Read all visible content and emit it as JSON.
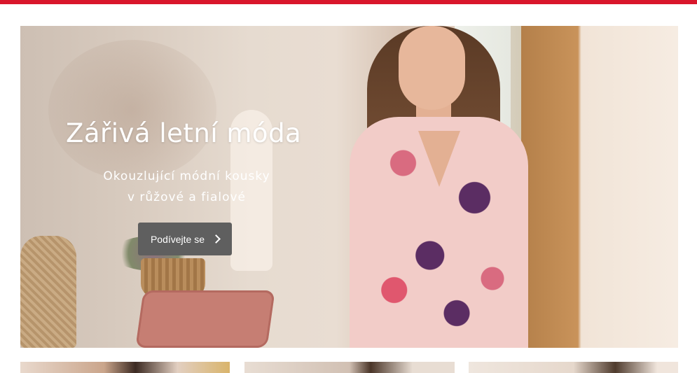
{
  "hero": {
    "title": "Zářivá letní móda",
    "subtitle_line1": "Okouzlující módní kousky",
    "subtitle_line2": "v růžové a fialové",
    "cta_label": "Podívejte se"
  },
  "colors": {
    "top_bar": "#d9162b",
    "button_bg": "#5f5f5f",
    "text_on_hero": "#ffffff"
  },
  "icons": {
    "cta_icon": "chevron-right-icon"
  }
}
